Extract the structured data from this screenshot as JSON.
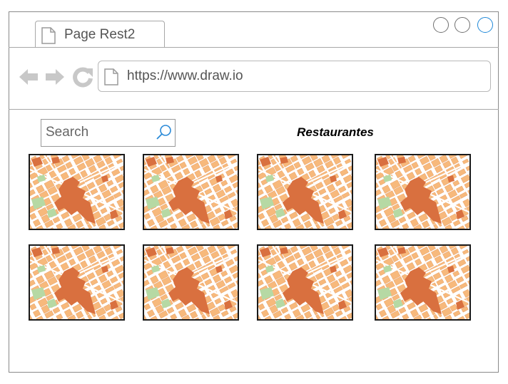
{
  "window": {
    "tab_title": "Page Rest2",
    "url": "https://www.draw.io"
  },
  "icons": {
    "tab": "page-icon",
    "back": "arrow-left-icon",
    "forward": "arrow-right-icon",
    "reload": "reload-icon",
    "url": "page-icon",
    "search": "search-icon"
  },
  "search": {
    "placeholder": "Search"
  },
  "heading": "Restaurantes",
  "gallery": {
    "tile_image": "city-map",
    "tiles": 8
  },
  "colors": {
    "map_building": "#f7b97c",
    "map_landmark": "#d9703f",
    "map_park": "#b6d9a4",
    "map_street": "#ffffff",
    "close_button": "#1e88d8"
  }
}
